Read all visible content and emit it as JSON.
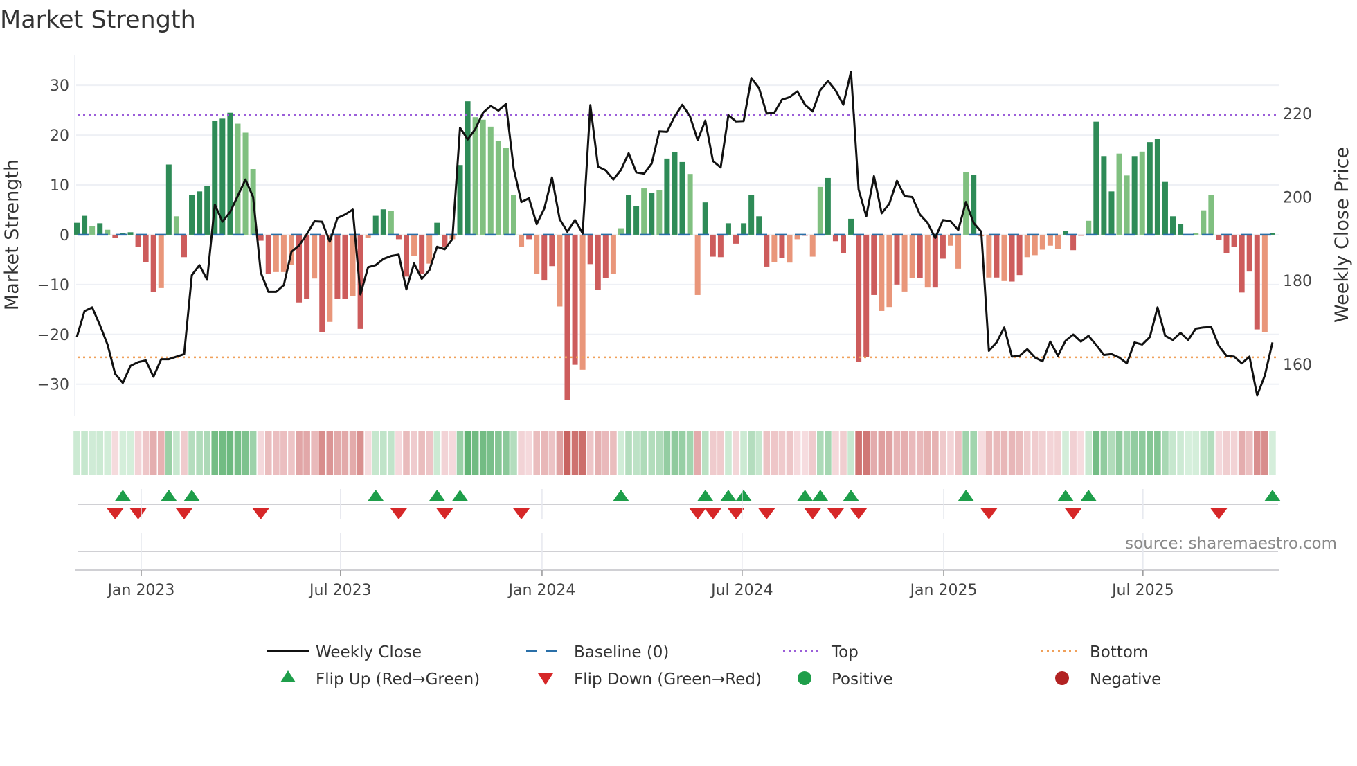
{
  "chart_data": {
    "type": "bar",
    "title": "Market Strength",
    "ylabel": "Market Strength",
    "ylabel_right": "Weekly Close Price",
    "ylim": [
      -36.3,
      36
    ],
    "ylim_right": [
      147.7,
      233.9
    ],
    "yticks": [
      30,
      20,
      10,
      0,
      -10,
      -20,
      -30
    ],
    "yticks_right": [
      220,
      200,
      180,
      160
    ],
    "x_unit": "week index",
    "xticks": [
      {
        "label": "Jan 2023",
        "week": 9.4
      },
      {
        "label": "Jul 2023",
        "week": 35.4
      },
      {
        "label": "Jan 2024",
        "week": 61.7
      },
      {
        "label": "Jul 2024",
        "week": 87.8
      },
      {
        "label": "Jan 2025",
        "week": 114.1
      },
      {
        "label": "Jul 2025",
        "week": 140.1
      }
    ],
    "top_level": 24,
    "bottom_level": -24.6,
    "strength": [
      2.4,
      3.8,
      1.7,
      2.3,
      1.0,
      -0.6,
      0.4,
      0.5,
      -2.4,
      -5.5,
      -11.5,
      -10.7,
      14.1,
      3.7,
      -4.5,
      8.0,
      8.7,
      9.8,
      22.8,
      23.3,
      24.5,
      22.3,
      20.5,
      13.2,
      -1.2,
      -7.8,
      -7.5,
      -7.5,
      -6.0,
      -13.6,
      -12.9,
      -8.8,
      -19.6,
      -17.5,
      -12.8,
      -12.8,
      -12.3,
      -18.9,
      -0.6,
      3.8,
      5.1,
      4.8,
      -0.9,
      -8.4,
      -4.3,
      -7.8,
      -5.8,
      2.4,
      -2.4,
      -0.9,
      14.0,
      26.8,
      23.6,
      23.1,
      21.7,
      18.9,
      17.4,
      8.0,
      -2.4,
      -0.9,
      -7.8,
      -9.2,
      -6.3,
      -14.4,
      -33.2,
      -26.1,
      -27.1,
      -5.9,
      -11.0,
      -8.7,
      -7.8,
      1.3,
      8.0,
      5.8,
      9.3,
      8.4,
      8.9,
      15.3,
      16.6,
      14.6,
      12.2,
      -12.1,
      6.5,
      -4.4,
      -4.5,
      2.3,
      -1.8,
      2.3,
      8.0,
      3.7,
      -6.4,
      -5.5,
      -4.6,
      -5.6,
      -0.9,
      -0.2,
      -4.4,
      9.6,
      11.4,
      -1.3,
      -3.7,
      3.2,
      -25.5,
      -24.6,
      -12.1,
      -15.3,
      -14.5,
      -10.0,
      -11.4,
      -8.7,
      -8.7,
      -10.6,
      -10.6,
      -4.8,
      -2.2,
      -6.8,
      12.6,
      12.0,
      -0.3,
      -8.6,
      -8.6,
      -9.3,
      -9.4,
      -8.1,
      -4.5,
      -4.1,
      -3.0,
      -2.2,
      -2.8,
      0.7,
      -3.1,
      -0.2,
      2.8,
      22.7,
      15.8,
      8.7,
      16.3,
      11.9,
      15.8,
      16.7,
      18.6,
      19.3,
      10.6,
      3.7,
      2.2,
      0.1,
      0.4,
      4.9,
      8.0,
      -1.0,
      -3.7,
      -2.5,
      -11.6,
      -7.4,
      -19.0,
      -19.6,
      0.3
    ],
    "shade": "ddldlddddddldldddddddlllddlllddldlddldlddlddldlddlddllllllldlddlddldddllddldldddlldddddddddldlldlldddddddlldlldlddllldlldlddllllldddldddlldldddddllllddddddldlddl",
    "weekly_close": [
      166.5,
      172.7,
      173.6,
      169.4,
      164.7,
      157.7,
      155.5,
      159.6,
      160.5,
      160.9,
      157.0,
      161.2,
      161.2,
      161.8,
      162.4,
      181.3,
      183.7,
      180.2,
      198.2,
      194.1,
      196.4,
      200.3,
      204.2,
      200.0,
      181.9,
      177.3,
      177.3,
      178.9,
      186.9,
      188.4,
      191.1,
      194.2,
      194.1,
      189.3,
      195.0,
      195.8,
      197.0,
      176.7,
      183.2,
      183.7,
      185.2,
      185.9,
      186.2,
      177.9,
      184.1,
      180.4,
      182.5,
      188.1,
      187.5,
      189.9,
      216.6,
      213.8,
      216.3,
      220.2,
      221.8,
      220.7,
      222.3,
      206.8,
      198.8,
      199.7,
      193.5,
      197.3,
      204.7,
      194.7,
      191.7,
      194.5,
      191.3,
      222.0,
      207.3,
      206.4,
      204.2,
      206.5,
      210.5,
      205.9,
      205.6,
      208.0,
      215.7,
      215.6,
      219.3,
      222.1,
      219.3,
      213.6,
      218.3,
      208.6,
      207.1,
      219.6,
      218.1,
      218.2,
      228.5,
      226.1,
      220.0,
      220.2,
      223.3,
      223.9,
      225.3,
      222.1,
      220.5,
      225.6,
      227.8,
      225.5,
      222.1,
      230.0,
      201.8,
      195.4,
      205.0,
      196.1,
      198.4,
      203.9,
      200.2,
      200.0,
      195.8,
      193.8,
      190.2,
      194.5,
      194.2,
      192.1,
      198.8,
      193.8,
      191.7,
      163.2,
      165.2,
      168.8,
      161.8,
      162.0,
      163.6,
      161.6,
      160.7,
      165.4,
      162.0,
      165.6,
      167.1,
      165.4,
      166.8,
      164.6,
      162.2,
      162.4,
      161.6,
      160.2,
      165.2,
      164.7,
      166.5,
      173.6,
      166.8,
      165.8,
      167.5,
      165.8,
      168.5,
      168.8,
      168.9,
      164.4,
      162.0,
      161.8,
      160.2,
      161.8,
      152.5,
      157.3,
      165.2
    ],
    "flip_up_weeks": [
      7,
      13,
      16,
      40,
      48,
      51,
      72,
      83,
      86,
      88,
      96,
      98,
      102,
      117,
      130,
      133,
      157
    ],
    "flip_down_weeks": [
      6,
      9,
      15,
      25,
      43,
      49,
      59,
      82,
      84,
      87,
      91,
      97,
      100,
      103,
      120,
      131,
      150
    ],
    "legend": {
      "placement": "bottom",
      "weekly_close": "Weekly Close",
      "baseline": "Baseline (0)",
      "top": "Top",
      "bottom": "Bottom",
      "flip_up": "Flip Up (Red→Green)",
      "flip_down": "Flip Down (Green→Red)",
      "positive": "Positive",
      "negative": "Negative"
    },
    "source": "source: sharemaestro.com",
    "colors": {
      "pos_dark": "#2e8b57",
      "pos_light": "#80c080",
      "neg_dark": "#cd5c5c",
      "neg_light": "#e9967a",
      "line": "#111111",
      "baseline": "#2a6fa8",
      "top": "#9b5fd9",
      "bottom": "#f0a05a",
      "flip_up": "#1e9e4a",
      "flip_down": "#d62728",
      "positive": "#1e9e4a",
      "negative": "#b22222"
    }
  }
}
